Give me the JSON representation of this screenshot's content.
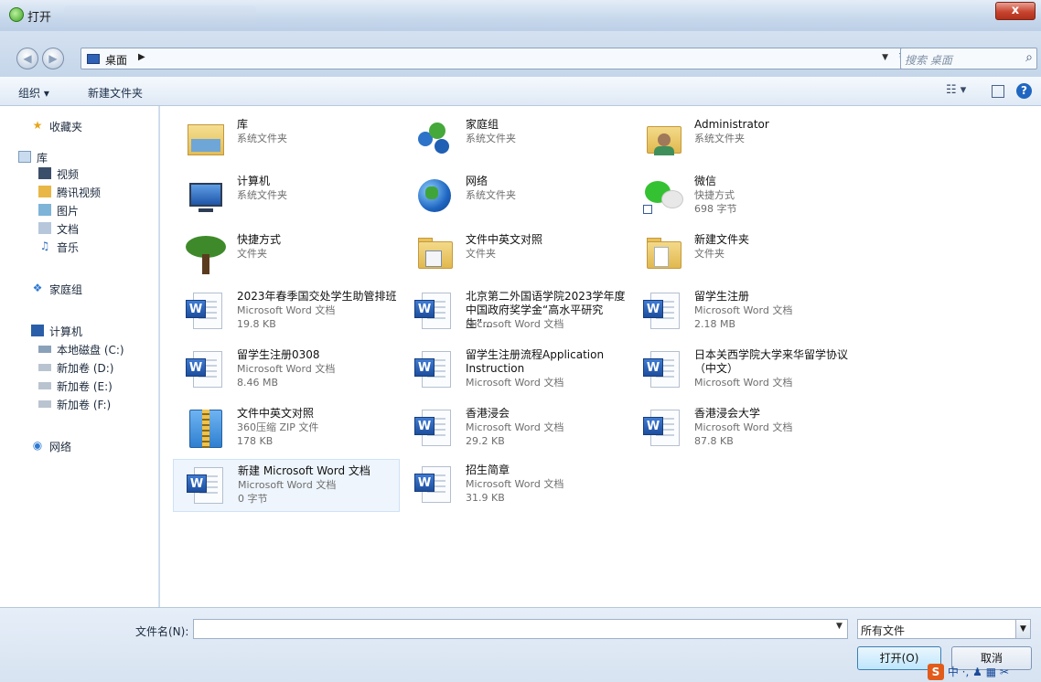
{
  "window": {
    "title": "打开",
    "close_label": "x"
  },
  "address": {
    "location": "桌面",
    "search_placeholder": "搜索 桌面"
  },
  "toolbar": {
    "organize": "组织 ▾",
    "new_folder": "新建文件夹"
  },
  "nav": {
    "favorites": "收藏夹",
    "libraries": "库",
    "lib_items": [
      "视频",
      "腾讯视频",
      "图片",
      "文档",
      "音乐"
    ],
    "homegroup": "家庭组",
    "computer": "计算机",
    "drives": [
      "本地磁盘 (C:)",
      "新加卷 (D:)",
      "新加卷 (E:)",
      "新加卷 (F:)"
    ],
    "network": "网络"
  },
  "files": [
    {
      "name": "库",
      "sub1": "系统文件夹",
      "sub2": "",
      "icon": "library-icon"
    },
    {
      "name": "家庭组",
      "sub1": "系统文件夹",
      "sub2": "",
      "icon": "homegroup-icon"
    },
    {
      "name": "Administrator",
      "sub1": "系统文件夹",
      "sub2": "",
      "icon": "user-folder-icon"
    },
    {
      "name": "计算机",
      "sub1": "系统文件夹",
      "sub2": "",
      "icon": "computer-icon"
    },
    {
      "name": "网络",
      "sub1": "系统文件夹",
      "sub2": "",
      "icon": "network-icon"
    },
    {
      "name": "微信",
      "sub1": "快捷方式",
      "sub2": "698 字节",
      "icon": "wechat-icon"
    },
    {
      "name": "快捷方式",
      "sub1": "文件夹",
      "sub2": "",
      "icon": "tree-icon"
    },
    {
      "name": "文件中英文对照",
      "sub1": "文件夹",
      "sub2": "",
      "icon": "folder-icon"
    },
    {
      "name": "新建文件夹",
      "sub1": "文件夹",
      "sub2": "",
      "icon": "folder-icon"
    },
    {
      "name": "2023年春季国交处学生助管排班",
      "sub1": "Microsoft Word 文档",
      "sub2": "19.8 KB",
      "icon": "word-icon"
    },
    {
      "name": "北京第二外国语学院2023学年度中国政府奖学金“高水平研究生”...",
      "sub1": "Microsoft Word 文档",
      "sub2": "",
      "icon": "word-icon"
    },
    {
      "name": "留学生注册",
      "sub1": "Microsoft Word 文档",
      "sub2": "2.18 MB",
      "icon": "word-icon"
    },
    {
      "name": "留学生注册0308",
      "sub1": "Microsoft Word 文档",
      "sub2": "8.46 MB",
      "icon": "word-icon"
    },
    {
      "name": "留学生注册流程Application Instruction",
      "sub1": "Microsoft Word 文档",
      "sub2": "",
      "icon": "word-icon"
    },
    {
      "name": "日本关西学院大学来华留学协议（中文）",
      "sub1": "Microsoft Word 文档",
      "sub2": "",
      "icon": "word-icon"
    },
    {
      "name": "文件中英文对照",
      "sub1": "360压缩 ZIP 文件",
      "sub2": "178 KB",
      "icon": "zip-icon"
    },
    {
      "name": "香港浸会",
      "sub1": "Microsoft Word 文档",
      "sub2": "29.2 KB",
      "icon": "word-icon"
    },
    {
      "name": "香港浸会大学",
      "sub1": "Microsoft Word 文档",
      "sub2": "87.8 KB",
      "icon": "word-icon"
    },
    {
      "name": "新建 Microsoft Word 文档",
      "sub1": "Microsoft Word 文档",
      "sub2": "0 字节",
      "icon": "word-icon",
      "selected": true
    },
    {
      "name": "招生简章",
      "sub1": "Microsoft Word 文档",
      "sub2": "31.9 KB",
      "icon": "word-icon"
    }
  ],
  "bottom": {
    "filename_label": "文件名(N):",
    "filename_value": "",
    "filter_value": "所有文件",
    "open_label": "打开(O)",
    "cancel_label": "取消"
  },
  "ime": {
    "logo": "S",
    "lang": "中"
  }
}
